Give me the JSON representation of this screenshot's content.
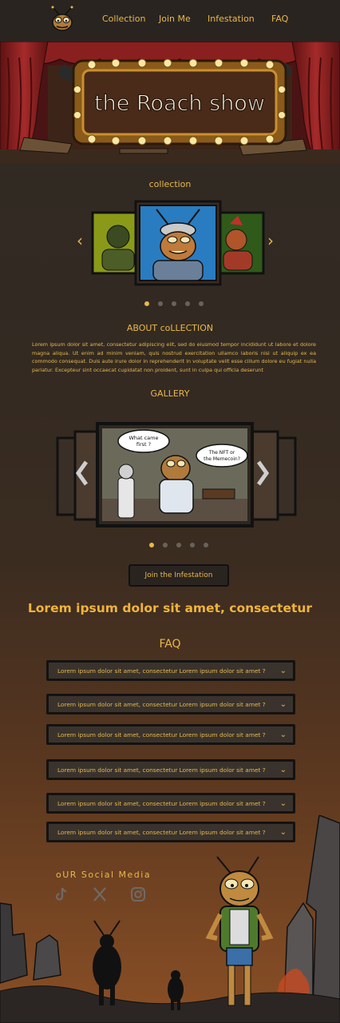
{
  "nav": {
    "items": [
      {
        "label": "Collection"
      },
      {
        "label": "Join Me"
      },
      {
        "label": "Infestation"
      },
      {
        "label": "FAQ"
      }
    ]
  },
  "hero": {
    "sign_text": "the Roach show"
  },
  "collection": {
    "title": "collection",
    "dots": 5,
    "active_dot": 0
  },
  "about": {
    "title": "ABOUT coLLECTION",
    "text": "Lorem ipsum dolor sit amet, consectetur adipiscing elit, sed do eiusmod tempor incididunt ut labore et dolore magna aliqua. Ut enim ad minim veniam, quis nostrud exercitation ullamco laboris nisi ut aliquip ex ea commodo consequat. Duis aute irure dolor in reprehenderit in voluptate velit esse cillum dolore eu fugiat nulla pariatur. Excepteur sint occaecat cupidatat non proident, sunt in culpa qui officia deserunt"
  },
  "gallery": {
    "title": "GALLERY",
    "bubble_left": "What came first ?",
    "bubble_right": "The NFT or the Memecoin?",
    "active_dot": 0
  },
  "join_button": "Join the Infestation",
  "tagline": "Lorem ipsum dolor sit amet, consectetur",
  "faq": {
    "title": "FAQ",
    "items": [
      {
        "q": "Lorem ipsum dolor sit amet, consectetur Lorem ipsum dolor sit amet ?"
      },
      {
        "q": "Lorem ipsum dolor sit amet, consectetur Lorem ipsum dolor sit amet ?"
      },
      {
        "q": "Lorem ipsum dolor sit amet, consectetur Lorem ipsum dolor sit amet ?"
      },
      {
        "q": "Lorem ipsum dolor sit amet, consectetur Lorem ipsum dolor sit amet ?"
      },
      {
        "q": "Lorem ipsum dolor sit amet, consectetur Lorem ipsum dolor sit amet ?"
      },
      {
        "q": "Lorem ipsum dolor sit amet, consectetur Lorem ipsum dolor sit amet ?"
      }
    ]
  },
  "social": {
    "title": "oUR Social Media",
    "icons": [
      "tiktok-icon",
      "x-icon",
      "instagram-icon"
    ]
  },
  "colors": {
    "accent": "#e8b84a",
    "nav_bg": "#2a2420",
    "curtain": "#8a1f1f"
  }
}
